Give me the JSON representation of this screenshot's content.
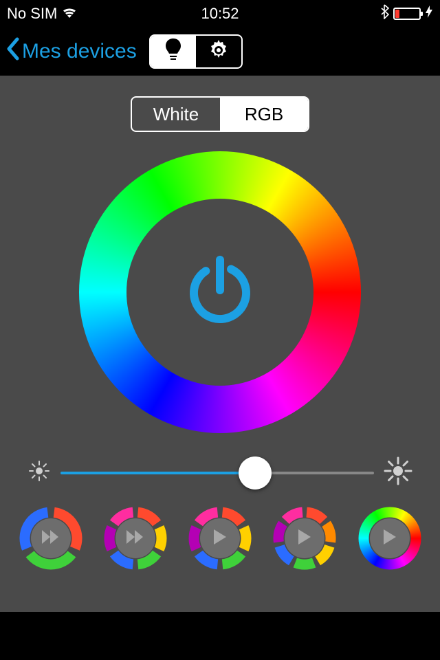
{
  "status": {
    "carrier": "No SIM",
    "time": "10:52"
  },
  "nav": {
    "back_label": "Mes devices"
  },
  "mode": {
    "white_label": "White",
    "rgb_label": "RGB",
    "active": "RGB"
  },
  "slider": {
    "value_percent": 62
  },
  "colors": {
    "accent": "#1ca0e3",
    "bg_main": "#4a4a4a"
  },
  "presets": [
    {
      "segments": [
        "#ff4a2e",
        "#3fd13a",
        "#2b6cff"
      ],
      "gaps": true,
      "action": "fast-forward"
    },
    {
      "segments": [
        "#ff4a2e",
        "#ffd000",
        "#3fd13a",
        "#2b6cff",
        "#b400b4",
        "#ff2da0"
      ],
      "gaps": true,
      "action": "fast-forward"
    },
    {
      "segments": [
        "#ff4a2e",
        "#ffd000",
        "#3fd13a",
        "#2b6cff",
        "#b400b4",
        "#ff2da0"
      ],
      "gaps": true,
      "action": "play"
    },
    {
      "segments": [
        "#ff4a2e",
        "#ff8a00",
        "#ffd000",
        "#3fd13a",
        "#2b6cff",
        "#b400b4",
        "#ff2da0"
      ],
      "gaps": true,
      "action": "play"
    },
    {
      "rainbow": true,
      "gaps": false,
      "action": "play"
    }
  ]
}
